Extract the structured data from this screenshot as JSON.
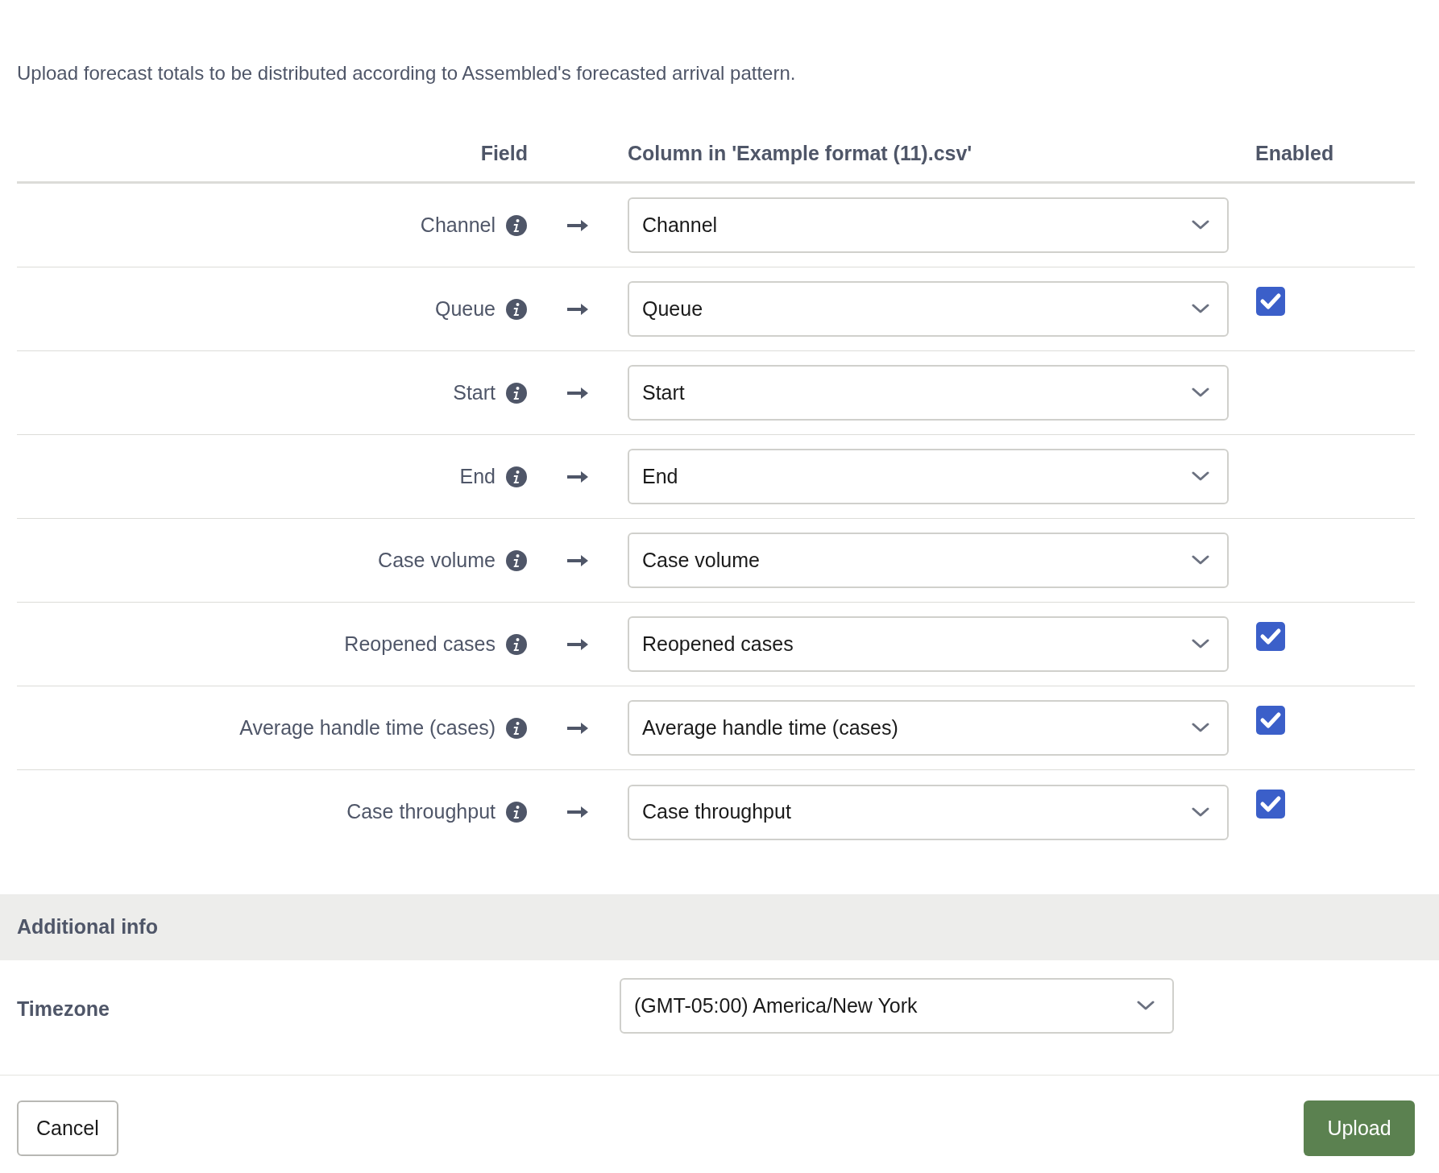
{
  "description": "Upload forecast totals to be distributed according to Assembled's forecasted arrival pattern.",
  "columns": [
    "Field",
    "Column in 'Example format (11).csv'",
    "Enabled"
  ],
  "rows": [
    {
      "field": "Channel",
      "column": "Channel",
      "enabled": false
    },
    {
      "field": "Queue",
      "column": "Queue",
      "enabled": true
    },
    {
      "field": "Start",
      "column": "Start",
      "enabled": false
    },
    {
      "field": "End",
      "column": "End",
      "enabled": false
    },
    {
      "field": "Case volume",
      "column": "Case volume",
      "enabled": false
    },
    {
      "field": "Reopened cases",
      "column": "Reopened cases",
      "enabled": true
    },
    {
      "field": "Average handle time (cases)",
      "column": "Average handle time (cases)",
      "enabled": true
    },
    {
      "field": "Case throughput",
      "column": "Case throughput",
      "enabled": true
    }
  ],
  "additional_info": {
    "title": "Additional info",
    "timezone_label": "Timezone",
    "timezone_value": "(GMT-05:00) America/New York"
  },
  "buttons": {
    "cancel": "Cancel",
    "upload": "Upload"
  }
}
